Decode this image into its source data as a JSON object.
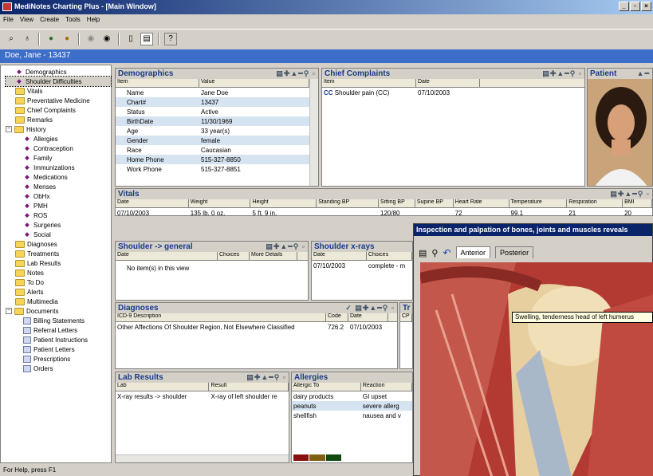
{
  "window": {
    "title": "MediNotes Charting Plus  - [Main Window]"
  },
  "menu": [
    "File",
    "View",
    "Create",
    "Tools",
    "Help"
  ],
  "patient_header": "Doe, Jane - 13437",
  "tree": [
    {
      "label": "Demographics",
      "icon": "doctor-icon",
      "level": 1
    },
    {
      "label": "Shoulder Difficulties",
      "icon": "doctor-icon",
      "level": 1
    },
    {
      "label": "Vitals",
      "icon": "folder-icon",
      "level": 1
    },
    {
      "label": "Preventative Medicine",
      "icon": "folder-icon",
      "level": 1
    },
    {
      "label": "Chief Complaints",
      "icon": "folder-icon",
      "level": 1
    },
    {
      "label": "Remarks",
      "icon": "folder-icon",
      "level": 1
    },
    {
      "label": "History",
      "icon": "folder-icon",
      "level": 0
    },
    {
      "label": "Allergies",
      "icon": "allergy-icon",
      "level": 2
    },
    {
      "label": "Contraception",
      "icon": "bc-icon",
      "level": 2
    },
    {
      "label": "Family",
      "icon": "family-icon",
      "level": 2
    },
    {
      "label": "Immunizations",
      "icon": "syringe-icon",
      "level": 2
    },
    {
      "label": "Medications",
      "icon": "pill-icon",
      "level": 2
    },
    {
      "label": "Menses",
      "icon": "menses-icon",
      "level": 2
    },
    {
      "label": "ObHx",
      "icon": "ob-icon",
      "level": 2
    },
    {
      "label": "PMH",
      "icon": "pmh-icon",
      "level": 2
    },
    {
      "label": "ROS",
      "icon": "rx-icon",
      "level": 2
    },
    {
      "label": "Surgeries",
      "icon": "scalpel-icon",
      "level": 2
    },
    {
      "label": "Social",
      "icon": "social-icon",
      "level": 2
    },
    {
      "label": "Diagnoses",
      "icon": "folder-icon",
      "level": 1
    },
    {
      "label": "Treatments",
      "icon": "folder-icon",
      "level": 1
    },
    {
      "label": "Lab Results",
      "icon": "folder-icon",
      "level": 1
    },
    {
      "label": "Notes",
      "icon": "folder-icon",
      "level": 1
    },
    {
      "label": "To Do",
      "icon": "folder-icon",
      "level": 1
    },
    {
      "label": "Alerts",
      "icon": "folder-icon",
      "level": 1
    },
    {
      "label": "Multimedia",
      "icon": "folder-icon",
      "level": 1
    },
    {
      "label": "Documents",
      "icon": "folder-icon",
      "level": 0
    },
    {
      "label": "Billing Statements",
      "icon": "doc-icon",
      "level": 2
    },
    {
      "label": "Referral Letters",
      "icon": "doc-icon",
      "level": 2
    },
    {
      "label": "Patient Instructions",
      "icon": "doc-icon",
      "level": 2
    },
    {
      "label": "Patient Letters",
      "icon": "doc-icon",
      "level": 2
    },
    {
      "label": "Prescriptions",
      "icon": "doc-icon",
      "level": 2
    },
    {
      "label": "Orders",
      "icon": "doc-icon",
      "level": 2
    }
  ],
  "demographics": {
    "title": "Demographics",
    "cols": [
      "Item",
      "Value"
    ],
    "rows": [
      [
        "Name",
        "Jane Doe"
      ],
      [
        "Chart#",
        "13437"
      ],
      [
        "Status",
        "Active"
      ],
      [
        "BirthDate",
        "11/30/1969"
      ],
      [
        "Age",
        "33 year(s)"
      ],
      [
        "Gender",
        "female"
      ],
      [
        "Race",
        "Caucasian"
      ],
      [
        "Home Phone",
        "515-327-8850"
      ],
      [
        "Work Phone",
        "515-327-8851"
      ]
    ]
  },
  "chief_complaints": {
    "title": "Chief Complaints",
    "cols": [
      "Item",
      "Date"
    ],
    "rows": [
      [
        "Shoulder pain (CC)",
        "07/10/2003"
      ]
    ]
  },
  "patient_panel": {
    "title": "Patient"
  },
  "vitals": {
    "title": "Vitals",
    "cols": [
      "Date",
      "Weight",
      "Height",
      "Standing BP",
      "Sitting BP",
      "Supine BP",
      "Heart Rate",
      "Temperature",
      "Respiration",
      "BMI"
    ],
    "rows": [
      [
        "07/10/2003",
        "135 lb. 0 oz.",
        "5 ft. 9 in.",
        "",
        "120/80",
        "",
        "72",
        "99.1",
        "21",
        "20"
      ]
    ]
  },
  "shoulder_general": {
    "title": "Shoulder -> general",
    "cols": [
      "Date",
      "Choices",
      "More Details"
    ],
    "empty": "No item(s) in this view"
  },
  "shoulder_xrays": {
    "title": "Shoulder x-rays",
    "cols": [
      "Date",
      "Choices"
    ],
    "rows": [
      [
        "07/10/2003",
        "complete - m"
      ]
    ]
  },
  "diagnoses": {
    "title": "Diagnoses",
    "cols": [
      "ICD-9 Description",
      "Code",
      "Date"
    ],
    "rows": [
      [
        "Other Affections Of Shoulder Region, Not Elsewhere Classified",
        "726.2",
        "07/10/2003"
      ]
    ]
  },
  "treatments": {
    "title": "Tr",
    "col": "CP"
  },
  "lab_results": {
    "title": "Lab Results",
    "cols": [
      "Lab",
      "Result"
    ],
    "rows": [
      [
        "X-ray results -> shoulder",
        "X-ray of left shoulder re"
      ]
    ]
  },
  "allergies": {
    "title": "Allergies",
    "cols": [
      "Allergic To",
      "Reaction"
    ],
    "rows": [
      [
        "dairy products",
        "GI upset"
      ],
      [
        "peanuts",
        "severe allerg"
      ],
      [
        "shellfish",
        "nausea and v"
      ]
    ]
  },
  "popup": {
    "title": "Inspection and palpation of bones, joints and muscles reveals",
    "tabs": [
      "Anterior",
      "Posterior"
    ],
    "tooltip": "Swelling, tenderness head of left humerus"
  },
  "status_text": "For Help, press F1"
}
